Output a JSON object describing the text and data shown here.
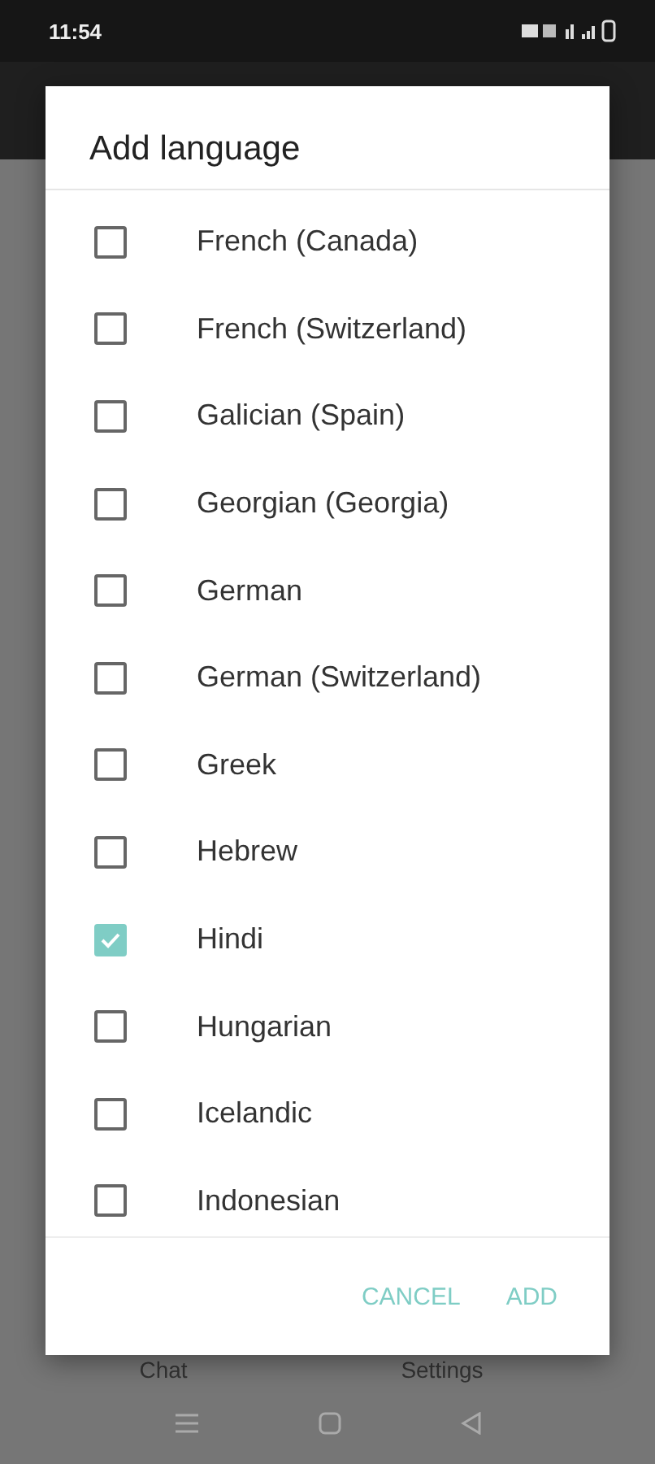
{
  "status_bar": {
    "time": "11:54"
  },
  "background": {
    "bottom_tabs": [
      "Chat",
      "Settings"
    ]
  },
  "dialog": {
    "title": "Add language",
    "items": [
      {
        "label": "French (Canada)",
        "checked": false
      },
      {
        "label": "French (Switzerland)",
        "checked": false
      },
      {
        "label": "Galician (Spain)",
        "checked": false
      },
      {
        "label": "Georgian (Georgia)",
        "checked": false
      },
      {
        "label": "German",
        "checked": false
      },
      {
        "label": "German (Switzerland)",
        "checked": false
      },
      {
        "label": "Greek",
        "checked": false
      },
      {
        "label": "Hebrew",
        "checked": false
      },
      {
        "label": "Hindi",
        "checked": true
      },
      {
        "label": "Hungarian",
        "checked": false
      },
      {
        "label": "Icelandic",
        "checked": false
      },
      {
        "label": "Indonesian",
        "checked": false
      }
    ],
    "buttons": [
      "CANCEL",
      "ADD"
    ]
  }
}
